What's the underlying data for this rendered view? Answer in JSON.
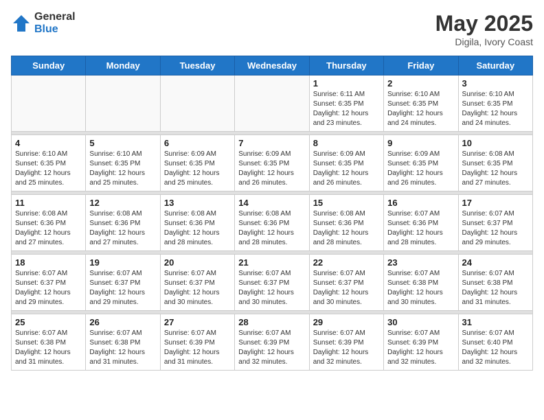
{
  "header": {
    "logo_general": "General",
    "logo_blue": "Blue",
    "month_year": "May 2025",
    "location": "Digila, Ivory Coast"
  },
  "days_of_week": [
    "Sunday",
    "Monday",
    "Tuesday",
    "Wednesday",
    "Thursday",
    "Friday",
    "Saturday"
  ],
  "weeks": [
    [
      {
        "day": "",
        "info": ""
      },
      {
        "day": "",
        "info": ""
      },
      {
        "day": "",
        "info": ""
      },
      {
        "day": "",
        "info": ""
      },
      {
        "day": "1",
        "info": "Sunrise: 6:11 AM\nSunset: 6:35 PM\nDaylight: 12 hours\nand 23 minutes."
      },
      {
        "day": "2",
        "info": "Sunrise: 6:10 AM\nSunset: 6:35 PM\nDaylight: 12 hours\nand 24 minutes."
      },
      {
        "day": "3",
        "info": "Sunrise: 6:10 AM\nSunset: 6:35 PM\nDaylight: 12 hours\nand 24 minutes."
      }
    ],
    [
      {
        "day": "4",
        "info": "Sunrise: 6:10 AM\nSunset: 6:35 PM\nDaylight: 12 hours\nand 25 minutes."
      },
      {
        "day": "5",
        "info": "Sunrise: 6:10 AM\nSunset: 6:35 PM\nDaylight: 12 hours\nand 25 minutes."
      },
      {
        "day": "6",
        "info": "Sunrise: 6:09 AM\nSunset: 6:35 PM\nDaylight: 12 hours\nand 25 minutes."
      },
      {
        "day": "7",
        "info": "Sunrise: 6:09 AM\nSunset: 6:35 PM\nDaylight: 12 hours\nand 26 minutes."
      },
      {
        "day": "8",
        "info": "Sunrise: 6:09 AM\nSunset: 6:35 PM\nDaylight: 12 hours\nand 26 minutes."
      },
      {
        "day": "9",
        "info": "Sunrise: 6:09 AM\nSunset: 6:35 PM\nDaylight: 12 hours\nand 26 minutes."
      },
      {
        "day": "10",
        "info": "Sunrise: 6:08 AM\nSunset: 6:35 PM\nDaylight: 12 hours\nand 27 minutes."
      }
    ],
    [
      {
        "day": "11",
        "info": "Sunrise: 6:08 AM\nSunset: 6:36 PM\nDaylight: 12 hours\nand 27 minutes."
      },
      {
        "day": "12",
        "info": "Sunrise: 6:08 AM\nSunset: 6:36 PM\nDaylight: 12 hours\nand 27 minutes."
      },
      {
        "day": "13",
        "info": "Sunrise: 6:08 AM\nSunset: 6:36 PM\nDaylight: 12 hours\nand 28 minutes."
      },
      {
        "day": "14",
        "info": "Sunrise: 6:08 AM\nSunset: 6:36 PM\nDaylight: 12 hours\nand 28 minutes."
      },
      {
        "day": "15",
        "info": "Sunrise: 6:08 AM\nSunset: 6:36 PM\nDaylight: 12 hours\nand 28 minutes."
      },
      {
        "day": "16",
        "info": "Sunrise: 6:07 AM\nSunset: 6:36 PM\nDaylight: 12 hours\nand 28 minutes."
      },
      {
        "day": "17",
        "info": "Sunrise: 6:07 AM\nSunset: 6:37 PM\nDaylight: 12 hours\nand 29 minutes."
      }
    ],
    [
      {
        "day": "18",
        "info": "Sunrise: 6:07 AM\nSunset: 6:37 PM\nDaylight: 12 hours\nand 29 minutes."
      },
      {
        "day": "19",
        "info": "Sunrise: 6:07 AM\nSunset: 6:37 PM\nDaylight: 12 hours\nand 29 minutes."
      },
      {
        "day": "20",
        "info": "Sunrise: 6:07 AM\nSunset: 6:37 PM\nDaylight: 12 hours\nand 30 minutes."
      },
      {
        "day": "21",
        "info": "Sunrise: 6:07 AM\nSunset: 6:37 PM\nDaylight: 12 hours\nand 30 minutes."
      },
      {
        "day": "22",
        "info": "Sunrise: 6:07 AM\nSunset: 6:37 PM\nDaylight: 12 hours\nand 30 minutes."
      },
      {
        "day": "23",
        "info": "Sunrise: 6:07 AM\nSunset: 6:38 PM\nDaylight: 12 hours\nand 30 minutes."
      },
      {
        "day": "24",
        "info": "Sunrise: 6:07 AM\nSunset: 6:38 PM\nDaylight: 12 hours\nand 31 minutes."
      }
    ],
    [
      {
        "day": "25",
        "info": "Sunrise: 6:07 AM\nSunset: 6:38 PM\nDaylight: 12 hours\nand 31 minutes."
      },
      {
        "day": "26",
        "info": "Sunrise: 6:07 AM\nSunset: 6:38 PM\nDaylight: 12 hours\nand 31 minutes."
      },
      {
        "day": "27",
        "info": "Sunrise: 6:07 AM\nSunset: 6:39 PM\nDaylight: 12 hours\nand 31 minutes."
      },
      {
        "day": "28",
        "info": "Sunrise: 6:07 AM\nSunset: 6:39 PM\nDaylight: 12 hours\nand 32 minutes."
      },
      {
        "day": "29",
        "info": "Sunrise: 6:07 AM\nSunset: 6:39 PM\nDaylight: 12 hours\nand 32 minutes."
      },
      {
        "day": "30",
        "info": "Sunrise: 6:07 AM\nSunset: 6:39 PM\nDaylight: 12 hours\nand 32 minutes."
      },
      {
        "day": "31",
        "info": "Sunrise: 6:07 AM\nSunset: 6:40 PM\nDaylight: 12 hours\nand 32 minutes."
      }
    ]
  ]
}
